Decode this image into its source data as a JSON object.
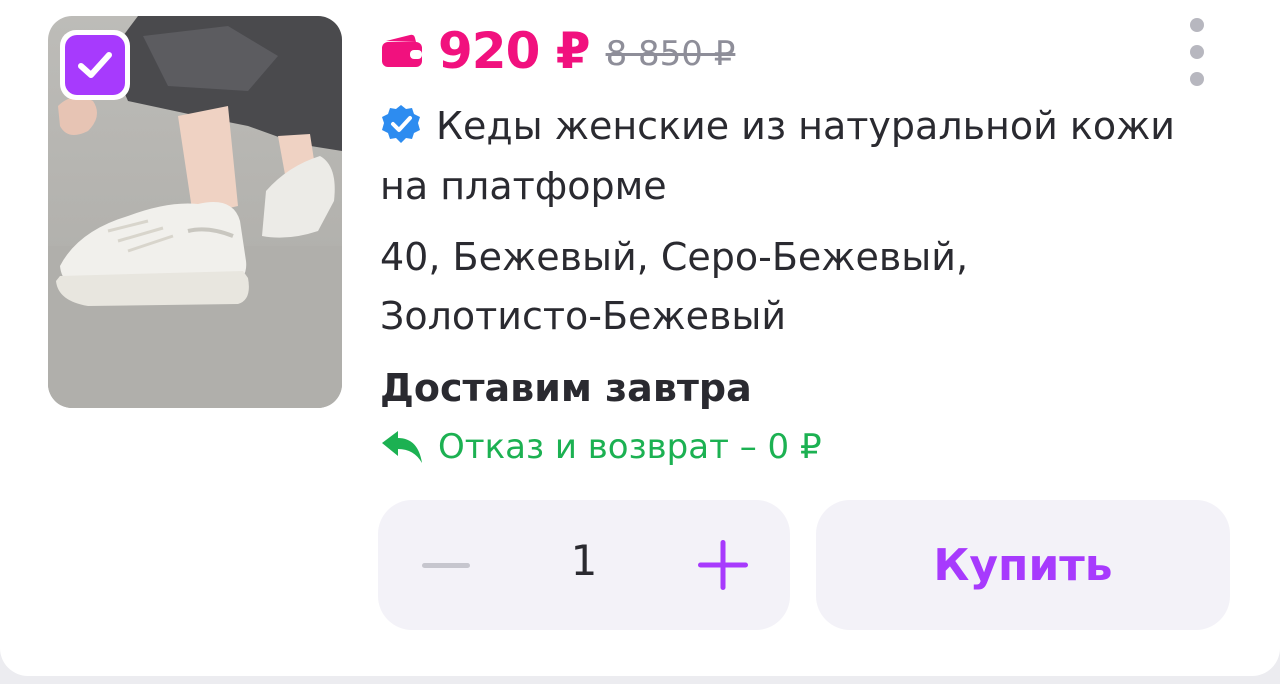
{
  "product": {
    "price": "920 ₽",
    "old_price": "8 850 ₽",
    "title": "Кеды женские из натуральной кожи на платформе",
    "variants_line1": "40, Бежевый, Серо-Бежевый,",
    "variants_line2": "Золотисто-Бежевый",
    "delivery": "Доставим завтра",
    "return_policy": "Отказ и возврат – 0 ₽",
    "selected": true
  },
  "quantity": {
    "value": "1"
  },
  "actions": {
    "buy_label": "Купить"
  },
  "icons": {
    "wallet": "wallet-icon",
    "verified": "verified-badge-icon",
    "return": "return-arrow-icon",
    "menu": "more-vertical-icon",
    "check": "checkmark-icon",
    "minus": "minus-icon",
    "plus": "plus-icon"
  },
  "colors": {
    "accent": "#a73afd",
    "price": "#f1117e",
    "old_price": "#8e8e99",
    "return": "#1cb152",
    "verified": "#2d8cf0",
    "button_bg": "#f3f2f8"
  }
}
